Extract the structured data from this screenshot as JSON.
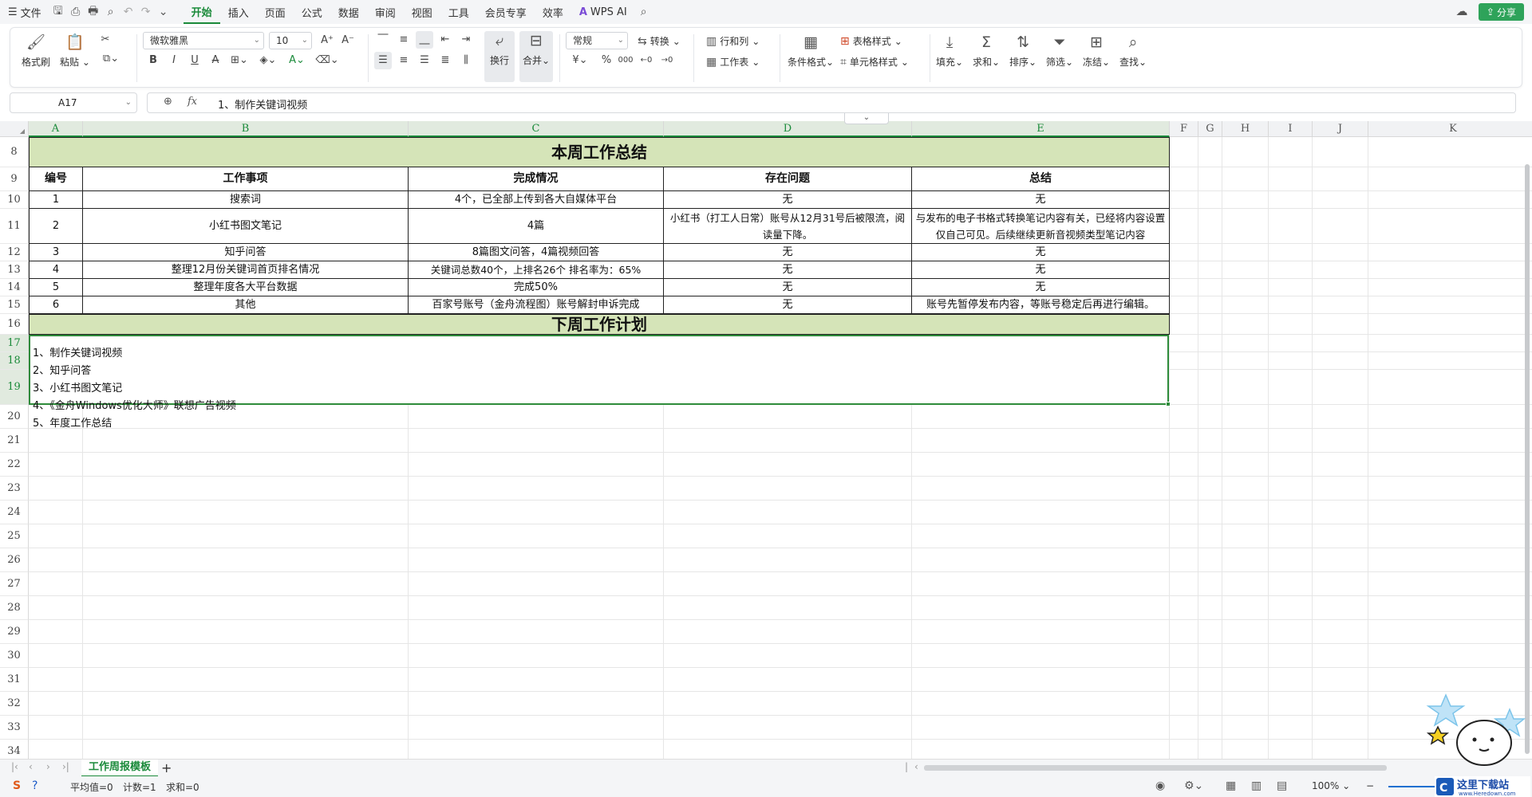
{
  "menu": {
    "file": "文件",
    "tabs": [
      "开始",
      "插入",
      "页面",
      "公式",
      "数据",
      "审阅",
      "视图",
      "工具",
      "会员专享",
      "效率"
    ],
    "active_tab": "开始",
    "wps_ai": "WPS AI",
    "share": "分享"
  },
  "ribbon": {
    "format_painter": "格式刷",
    "paste": "粘贴",
    "font_name": "微软雅黑",
    "font_size": "10",
    "wrap": "换行",
    "merge": "合并",
    "number_format": "常规",
    "convert": "转换",
    "row_col": "行和列",
    "worksheet": "工作表",
    "cond_format": "条件格式",
    "table_style": "表格样式",
    "cell_style": "单元格样式",
    "fill": "填充",
    "sum": "求和",
    "sort": "排序",
    "filter": "筛选",
    "freeze": "冻结",
    "find": "查找"
  },
  "formula_bar": {
    "cell_ref": "A17",
    "content": "1、制作关键词视频"
  },
  "columns": [
    "A",
    "B",
    "C",
    "D",
    "E",
    "F",
    "G",
    "H",
    "I",
    "J",
    "K"
  ],
  "rows": [
    "8",
    "9",
    "10",
    "11",
    "12",
    "13",
    "14",
    "15",
    "16",
    "17",
    "18",
    "19",
    "20",
    "21",
    "22",
    "23",
    "24",
    "25",
    "26",
    "27",
    "28",
    "29",
    "30",
    "31",
    "32",
    "33",
    "34"
  ],
  "sheet": {
    "title": "本周工作总结",
    "headers": [
      "编号",
      "工作事项",
      "完成情况",
      "存在问题",
      "总结"
    ],
    "table": [
      [
        "1",
        "搜索词",
        "4个，已全部上传到各大自媒体平台",
        "无",
        "无"
      ],
      [
        "2",
        "小红书图文笔记",
        "4篇",
        "小红书（打工人日常）账号从12月31号后被限流，阅读量下降。",
        "与发布的电子书格式转换笔记内容有关，已经将内容设置仅自己可见。后续继续更新音视频类型笔记内容"
      ],
      [
        "3",
        "知乎问答",
        "8篇图文问答，4篇视频回答",
        "无",
        "无"
      ],
      [
        "4",
        "整理12月份关键词首页排名情况",
        "关键词总数40个，上排名26个  排名率为：65%",
        "无",
        "无"
      ],
      [
        "5",
        "整理年度各大平台数据",
        "完成50%",
        "无",
        "无"
      ],
      [
        "6",
        "其他",
        "百家号账号（金舟流程图）账号解封申诉完成",
        "无",
        "账号先暂停发布内容，等账号稳定后再进行编辑。"
      ]
    ],
    "plan_title": "下周工作计划",
    "plan_items": [
      "1、制作关键词视频",
      "2、知乎问答",
      "3、小红书图文笔记",
      "4、《金舟Windows优化大师》联想广告视频",
      "5、年度工作总结"
    ]
  },
  "sheet_tab": "工作周报模板",
  "status": {
    "average": "平均值=0",
    "count": "计数=1",
    "sum": "求和=0",
    "zoom": "100%"
  },
  "watermark": {
    "site": "这里下载站",
    "url": "www.Heredown.com"
  },
  "colors": {
    "accent": "#1a8a3a",
    "title_fill": "#d5e4b8",
    "share_btn": "#2ea35a"
  }
}
